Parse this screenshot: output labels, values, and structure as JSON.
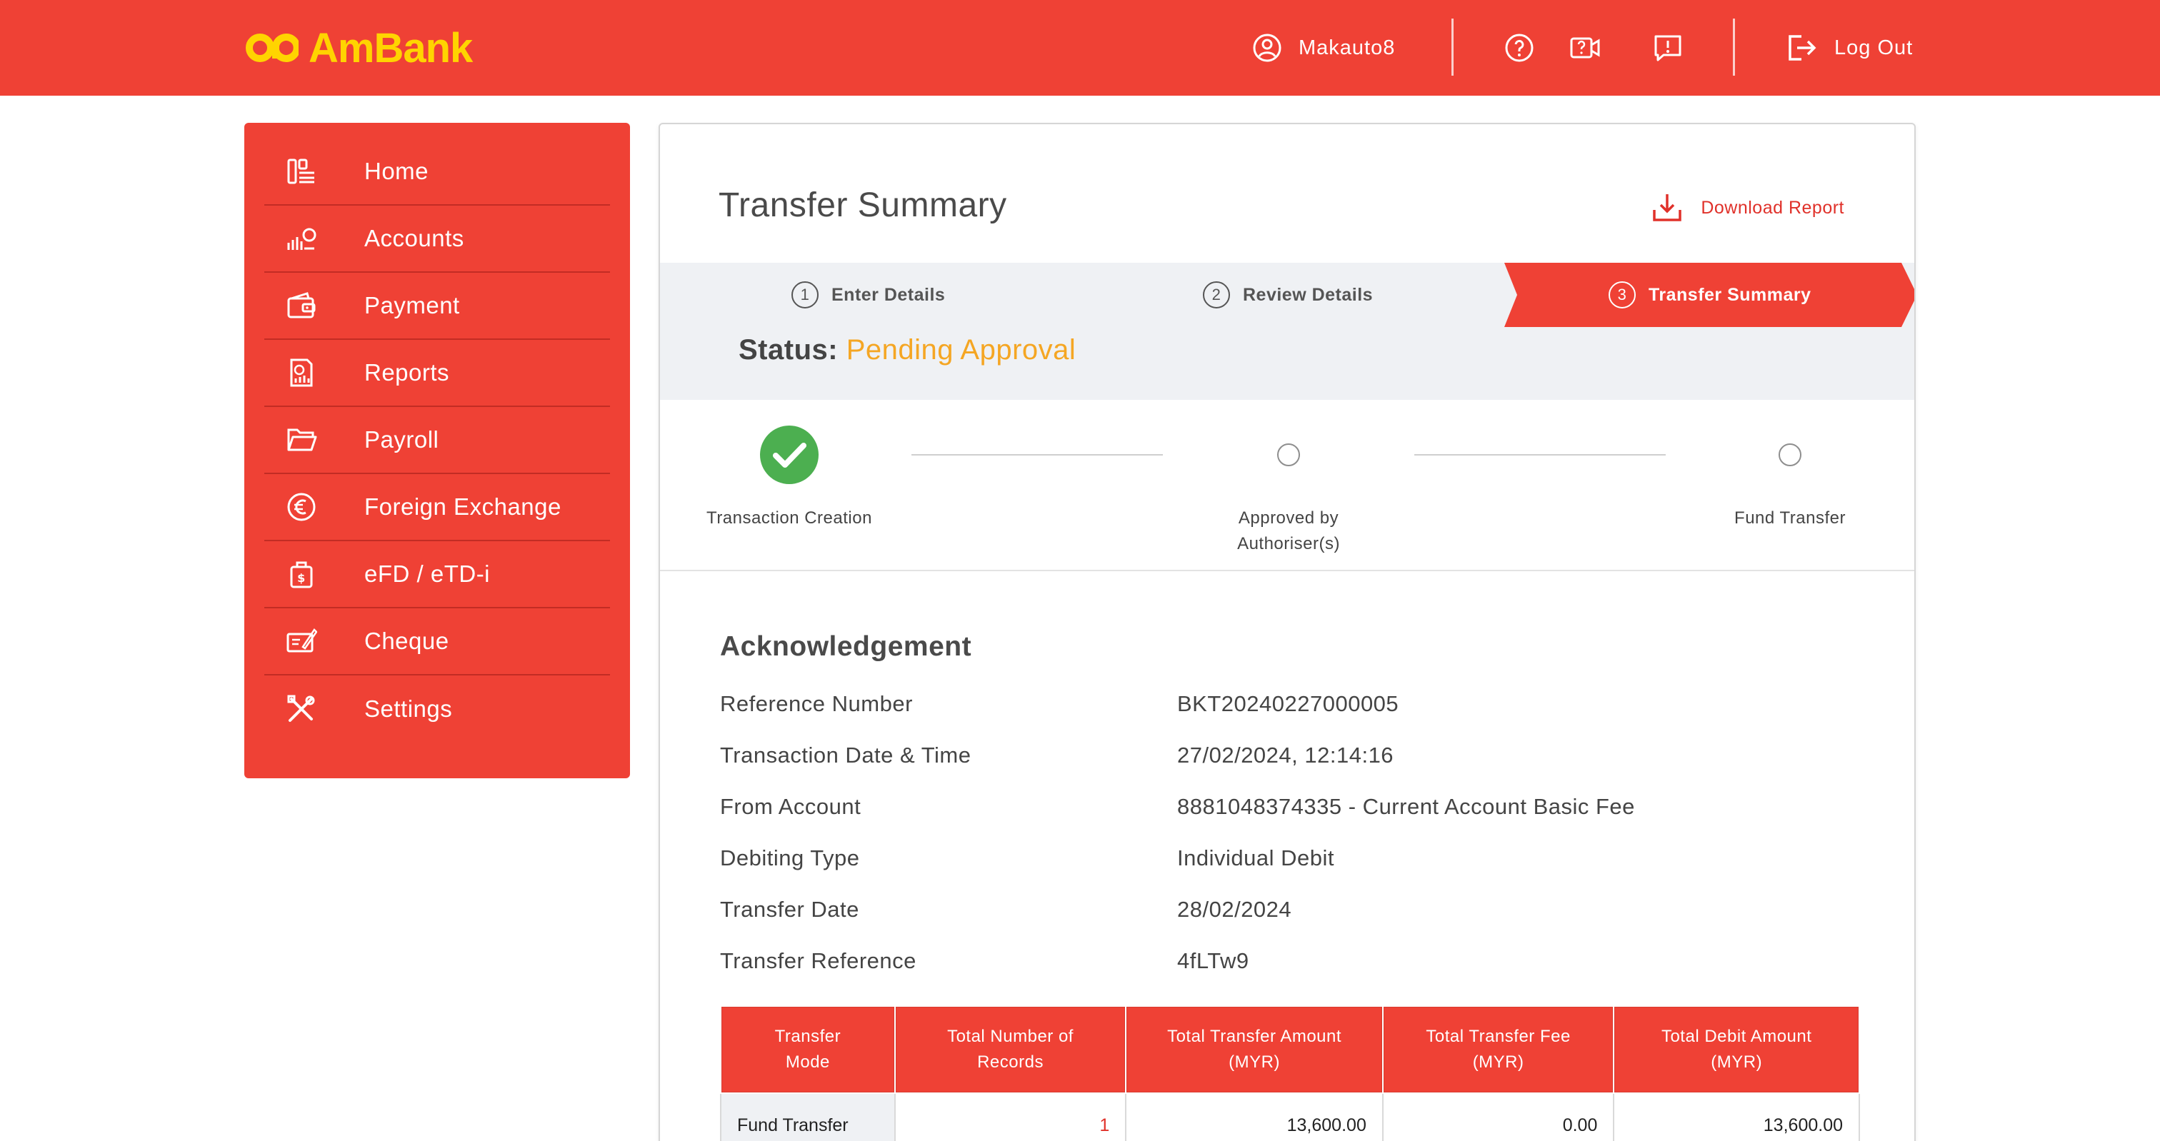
{
  "brand": {
    "name": "AmBank",
    "accent": "#ef4135",
    "logo_color": "#ffd400"
  },
  "topbar": {
    "username": "Makauto8",
    "icons": [
      "user-icon",
      "help-icon",
      "video-help-icon",
      "feedback-icon",
      "logout-icon"
    ],
    "logout_label": "Log Out"
  },
  "sidebar": {
    "items": [
      {
        "label": "Home",
        "icon": "home-icon"
      },
      {
        "label": "Accounts",
        "icon": "accounts-icon"
      },
      {
        "label": "Payment",
        "icon": "wallet-icon"
      },
      {
        "label": "Reports",
        "icon": "reports-icon"
      },
      {
        "label": "Payroll",
        "icon": "folder-icon"
      },
      {
        "label": "Foreign Exchange",
        "icon": "euro-icon"
      },
      {
        "label": "eFD / eTD-i",
        "icon": "deposit-icon"
      },
      {
        "label": "Cheque",
        "icon": "cheque-icon"
      },
      {
        "label": "Settings",
        "icon": "tools-icon"
      }
    ]
  },
  "main": {
    "title": "Transfer Summary",
    "download_label": "Download Report",
    "steps": [
      {
        "num": "1",
        "label": "Enter Details"
      },
      {
        "num": "2",
        "label": "Review Details"
      },
      {
        "num": "3",
        "label": "Transfer Summary"
      }
    ],
    "status_label": "Status:",
    "status_value": "Pending Approval",
    "status_color": "#f5a623",
    "progress": [
      {
        "label": "Transaction Creation",
        "done": true
      },
      {
        "label": "Approved by Authoriser(s)",
        "done": false
      },
      {
        "label": "Fund Transfer",
        "done": false
      }
    ],
    "ack_title": "Acknowledgement",
    "details": [
      {
        "key": "Reference Number",
        "value": "BKT20240227000005"
      },
      {
        "key": "Transaction Date & Time",
        "value": "27/02/2024, 12:14:16"
      },
      {
        "key": "From Account",
        "value": "8881048374335 - Current Account Basic Fee"
      },
      {
        "key": "Debiting Type",
        "value": "Individual Debit"
      },
      {
        "key": "Transfer Date",
        "value": "28/02/2024"
      },
      {
        "key": "Transfer Reference",
        "value": "4fLTw9"
      }
    ],
    "table": {
      "headers": [
        {
          "l1": "Transfer",
          "l2": "Mode"
        },
        {
          "l1": "Total Number of",
          "l2": "Records"
        },
        {
          "l1": "Total Transfer Amount",
          "l2": "(MYR)"
        },
        {
          "l1": "Total Transfer Fee",
          "l2": "(MYR)"
        },
        {
          "l1": "Total Debit Amount",
          "l2": "(MYR)"
        }
      ],
      "rows": [
        [
          "Fund Transfer",
          "1",
          "13,600.00",
          "0.00",
          "13,600.00"
        ]
      ]
    }
  }
}
